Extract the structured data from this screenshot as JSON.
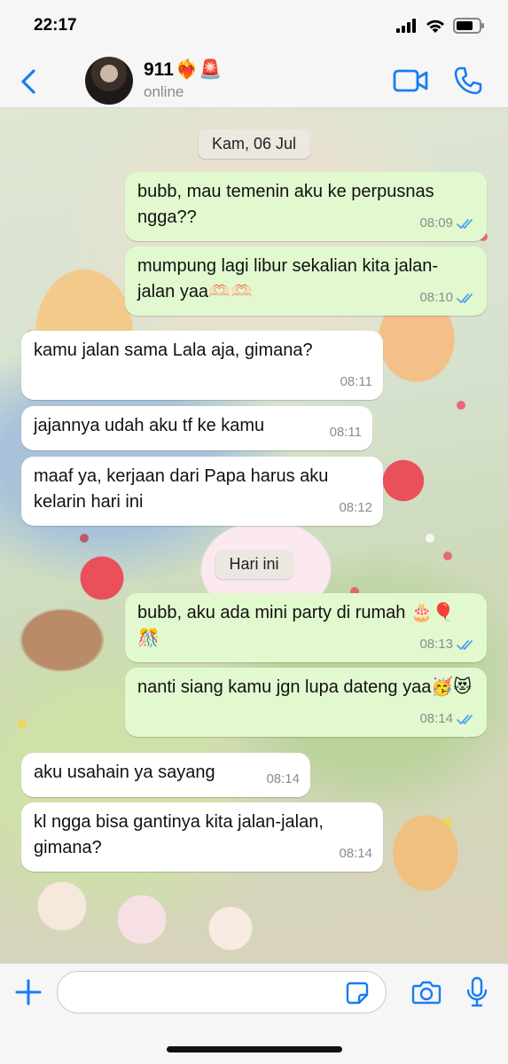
{
  "status_bar": {
    "time": "22:17"
  },
  "header": {
    "contact_name": "911",
    "name_emoji": "❤️‍🔥🚨",
    "status": "online"
  },
  "chat": {
    "date_1": "Kam, 06 Jul",
    "date_2": "Hari ini",
    "messages": [
      {
        "dir": "out",
        "text": "bubb, mau temenin aku ke perpusnas ngga??",
        "time": "08:09"
      },
      {
        "dir": "out",
        "text": "mumpung lagi libur sekalian kita jalan-jalan yaa🫶🏻🫶🏻",
        "time": "08:10"
      },
      {
        "dir": "in",
        "text": "kamu jalan sama Lala aja, gimana?",
        "time": "08:11"
      },
      {
        "dir": "in",
        "text": "jajannya udah aku tf ke kamu",
        "time": "08:11"
      },
      {
        "dir": "in",
        "text": "maaf ya, kerjaan dari Papa harus aku kelarin hari ini",
        "time": "08:12"
      },
      {
        "dir": "out",
        "text": "bubb, aku ada mini party di rumah 🎂🎈🎊",
        "time": "08:13"
      },
      {
        "dir": "out",
        "text": "nanti siang kamu jgn lupa dateng yaa🥳😻",
        "time": "08:14"
      },
      {
        "dir": "in",
        "text": "aku usahain ya sayang",
        "time": "08:14"
      },
      {
        "dir": "in",
        "text": "kl ngga bisa gantinya kita jalan-jalan, gimana?",
        "time": "08:14"
      }
    ]
  },
  "input": {
    "placeholder": ""
  },
  "colors": {
    "accent": "#1a7cf0",
    "outgoing_bubble": "#e2f9cf",
    "incoming_bubble": "#ffffff",
    "read_ticks": "#4fa6ea"
  },
  "icons": {
    "back": "chevron-left-icon",
    "video": "video-icon",
    "call": "phone-icon",
    "plus": "plus-icon",
    "sticker": "sticker-icon",
    "camera": "camera-icon",
    "mic": "microphone-icon"
  }
}
